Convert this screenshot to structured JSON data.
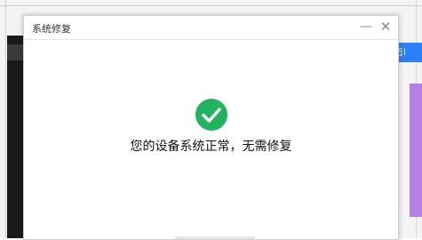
{
  "background": {
    "right_tab_label": "击i"
  },
  "dialog": {
    "title": "系统修复",
    "minimize_glyph": "—",
    "close_glyph": "✕",
    "status_icon": "check-circle-icon",
    "status_color": "#22b35e",
    "status_message": "您的设备系统正常，无需修复"
  }
}
